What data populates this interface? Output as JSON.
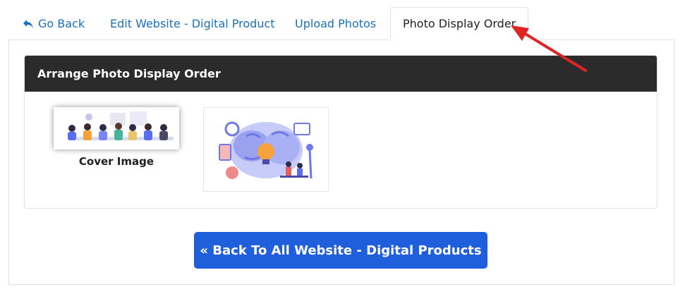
{
  "tabs": {
    "go_back": "Go Back",
    "edit_website": "Edit Website - Digital Product",
    "upload_photos": "Upload Photos",
    "photo_display_order": "Photo Display Order",
    "active": "Photo Display Order"
  },
  "card": {
    "title": "Arrange Photo Display Order"
  },
  "photos": [
    {
      "label": "Cover Image",
      "icon": "team-meeting-illustration"
    },
    {
      "label": "",
      "icon": "brain-lightbulb-illustration"
    }
  ],
  "actions": {
    "back_to_all": "« Back To All Website - Digital Products"
  },
  "colors": {
    "link": "#1a6fc0",
    "card_header": "#2b2b2b",
    "primary_button": "#1f5fdc",
    "annotation_arrow": "#e02424"
  }
}
